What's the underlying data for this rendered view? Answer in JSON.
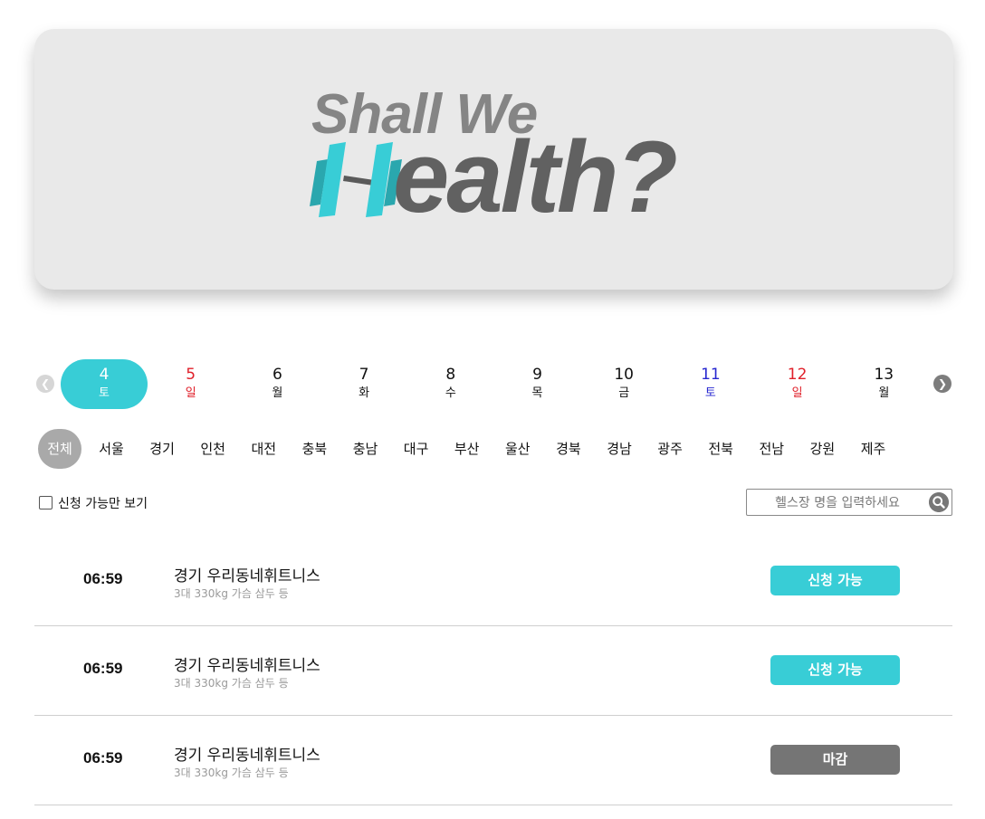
{
  "banner": {
    "logo_line1": "Shall We",
    "logo_line2": "ealth?",
    "accent_color": "#38cdd6",
    "icon": "dumbbell-icon"
  },
  "date_nav": {
    "prev_icon": "chevron-left-icon",
    "next_icon": "chevron-right-icon",
    "dates": [
      {
        "day": "4",
        "weekday": "토",
        "active": true
      },
      {
        "day": "5",
        "weekday": "일",
        "color": "#e0202a"
      },
      {
        "day": "6",
        "weekday": "월"
      },
      {
        "day": "7",
        "weekday": "화"
      },
      {
        "day": "8",
        "weekday": "수"
      },
      {
        "day": "9",
        "weekday": "목"
      },
      {
        "day": "10",
        "weekday": "금"
      },
      {
        "day": "11",
        "weekday": "토",
        "color": "#2727d0"
      },
      {
        "day": "12",
        "weekday": "일",
        "color": "#e0202a"
      },
      {
        "day": "13",
        "weekday": "월"
      }
    ]
  },
  "regions": [
    "전체",
    "서울",
    "경기",
    "인천",
    "대전",
    "충북",
    "충남",
    "대구",
    "부산",
    "울산",
    "경북",
    "경남",
    "광주",
    "전북",
    "전남",
    "강원",
    "제주"
  ],
  "filter": {
    "label": "신청 가능만 보기",
    "checked": false
  },
  "search": {
    "placeholder": "헬스장 명을 입력하세요",
    "icon": "search-icon"
  },
  "sessions": [
    {
      "time": "06:59",
      "name": "경기 우리동네휘트니스",
      "desc": "3대 330kg 가슴 삼두 등",
      "status": "신청 가능",
      "status_color": "#38cdd6"
    },
    {
      "time": "06:59",
      "name": "경기 우리동네휘트니스",
      "desc": "3대 330kg 가슴 삼두 등",
      "status": "신청 가능",
      "status_color": "#38cdd6"
    },
    {
      "time": "06:59",
      "name": "경기 우리동네휘트니스",
      "desc": "3대 330kg 가슴 삼두 등",
      "status": "마감",
      "status_color": "#757575"
    }
  ]
}
